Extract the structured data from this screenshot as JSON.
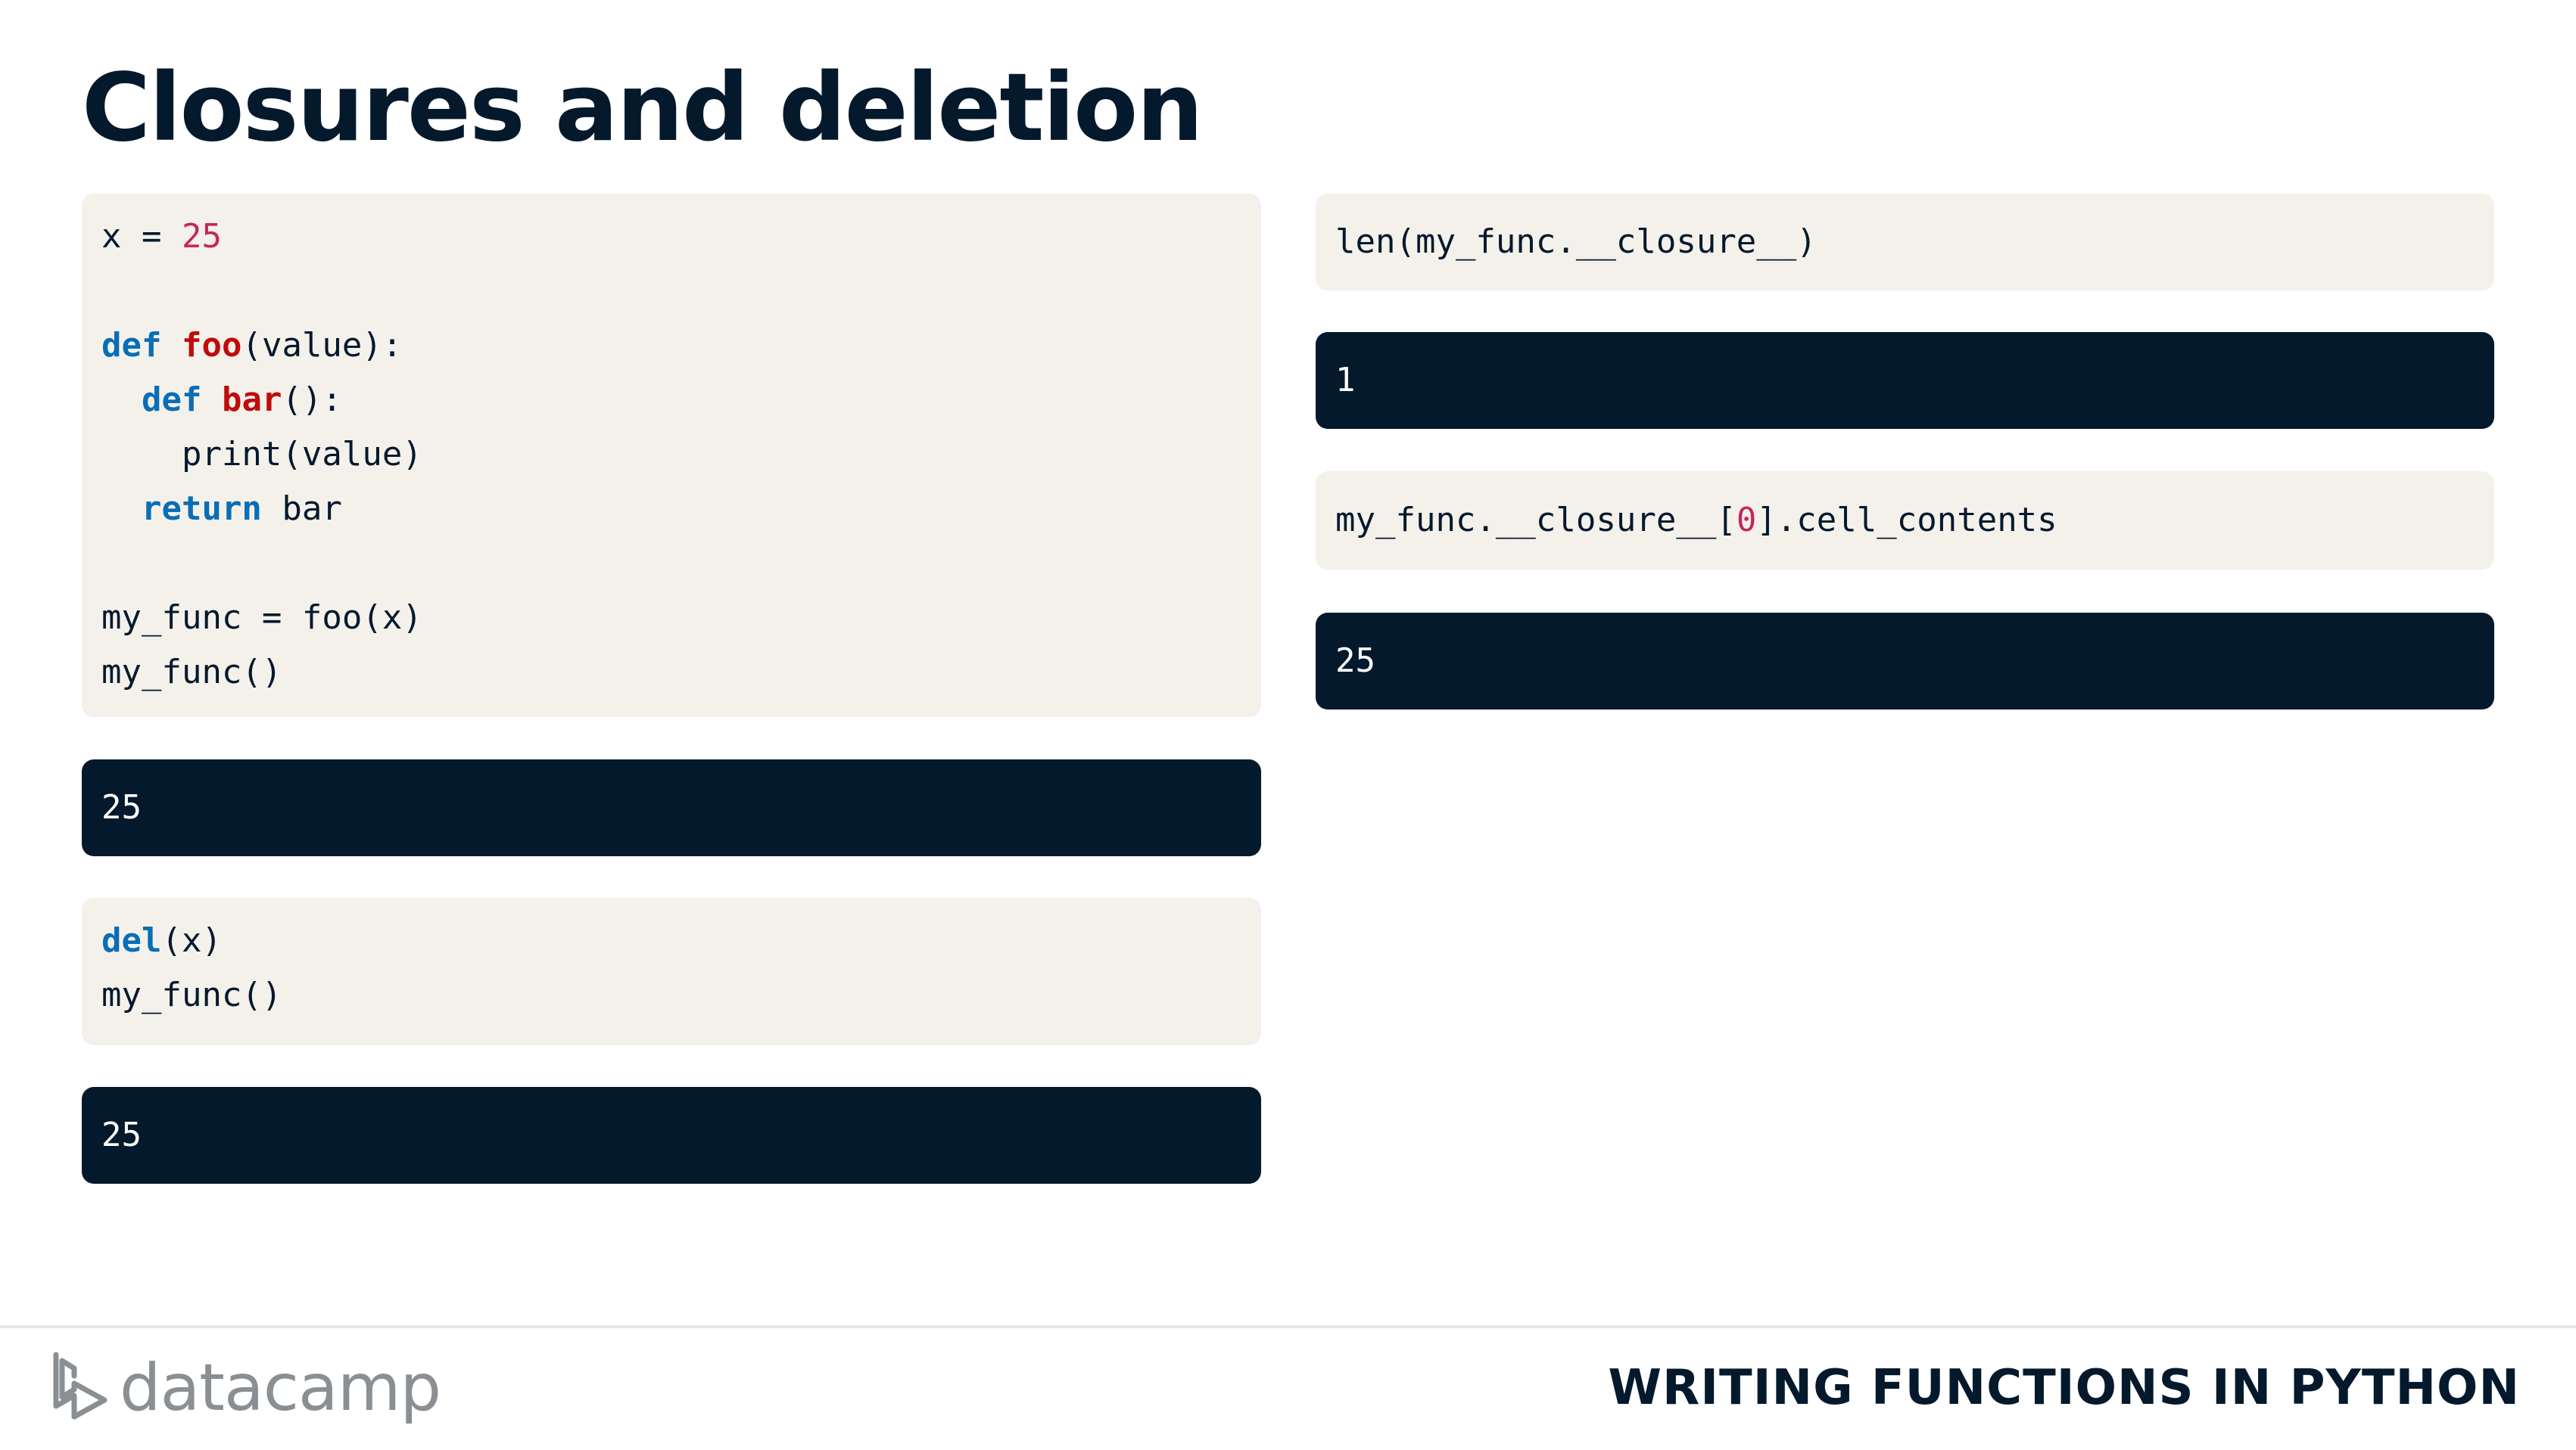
{
  "slide": {
    "title": "Closures and deletion",
    "course": "WRITING FUNCTIONS IN PYTHON",
    "brand": "datacamp"
  },
  "code_blocks": {
    "block1": {
      "lines": [
        [
          {
            "t": "x = ",
            "c": ""
          },
          {
            "t": "25",
            "c": "num"
          }
        ],
        [
          {
            "t": " ",
            "c": ""
          }
        ],
        [
          {
            "t": "def",
            "c": "kw"
          },
          {
            "t": " ",
            "c": ""
          },
          {
            "t": "foo",
            "c": "fn"
          },
          {
            "t": "(value):",
            "c": ""
          }
        ],
        [
          {
            "t": "  ",
            "c": ""
          },
          {
            "t": "def",
            "c": "kw"
          },
          {
            "t": " ",
            "c": ""
          },
          {
            "t": "bar",
            "c": "fn"
          },
          {
            "t": "():",
            "c": ""
          }
        ],
        [
          {
            "t": "    print(value)",
            "c": ""
          }
        ],
        [
          {
            "t": "  ",
            "c": ""
          },
          {
            "t": "return",
            "c": "kw"
          },
          {
            "t": " bar",
            "c": ""
          }
        ],
        [
          {
            "t": " ",
            "c": ""
          }
        ],
        [
          {
            "t": "my_func = foo(x)",
            "c": ""
          }
        ],
        [
          {
            "t": "my_func()",
            "c": ""
          }
        ]
      ]
    },
    "output1": "25",
    "block2": {
      "lines": [
        [
          {
            "t": "del",
            "c": "kw"
          },
          {
            "t": "(x)",
            "c": ""
          }
        ],
        [
          {
            "t": "my_func()",
            "c": ""
          }
        ]
      ]
    },
    "output2": "25",
    "block3": {
      "lines": [
        [
          {
            "t": "len(my_func.__closure__)",
            "c": ""
          }
        ]
      ]
    },
    "output3": "1",
    "block4": {
      "lines": [
        [
          {
            "t": "my_func.__closure__[",
            "c": ""
          },
          {
            "t": "0",
            "c": "num"
          },
          {
            "t": "].cell_contents",
            "c": ""
          }
        ]
      ]
    },
    "output4": "25"
  },
  "colors": {
    "title": "#05192d",
    "code_background": "#f4f1eb",
    "output_background": "#05192d",
    "keyword": "#0a6eb5",
    "function_name": "#c00b0b",
    "number": "#c7255e"
  },
  "icons": {
    "logo": "datacamp-logo-icon"
  }
}
